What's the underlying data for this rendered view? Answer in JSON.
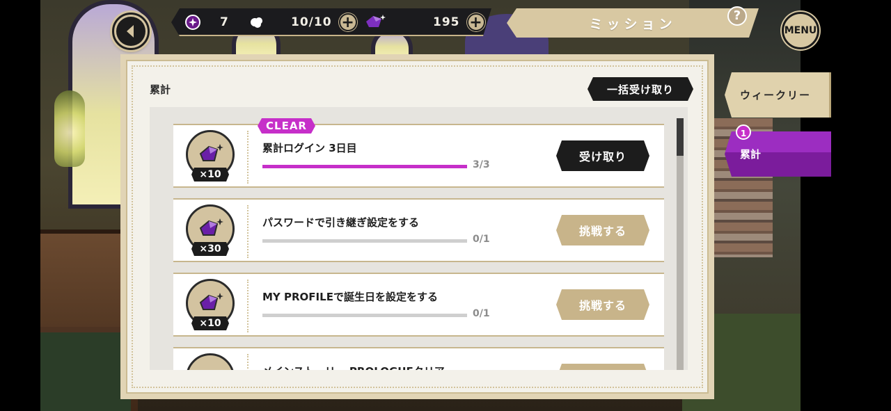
{
  "top_bar": {
    "event_currency": "7",
    "stamina": "10/10",
    "gems": "195",
    "mission_title": "ミッション",
    "help": "?",
    "menu": "MENU"
  },
  "panel": {
    "section_label": "累計",
    "claim_all": "一括受け取り"
  },
  "missions": [
    {
      "clear": "CLEAR",
      "reward_count": "×10",
      "name": "累計ログイン 3日目",
      "progress_text": "3/3",
      "progress": 1.0,
      "action": "受け取り"
    },
    {
      "reward_count": "×30",
      "name": "パスワードで引き継ぎ設定をする",
      "progress_text": "0/1",
      "progress": 0.0,
      "action": "挑戦する"
    },
    {
      "reward_count": "×10",
      "name": "MY PROFILEで誕生日を設定をする",
      "progress_text": "0/1",
      "progress": 0.0,
      "action": "挑戦する"
    },
    {
      "name": "メインストーリー PROLOGUEクリア"
    }
  ],
  "tabs": {
    "weekly": "ウィークリー",
    "cumulative": "累計",
    "cumulative_badge": "1"
  },
  "colors": {
    "accent_magenta": "#c62fc9",
    "tab_active_purple": "#7b1c9c",
    "gold": "#c8b48a",
    "button_dark": "#1c1c1c"
  },
  "icons": [
    "back-arrow-icon",
    "event-token-icon",
    "stamina-icon",
    "gem-icon",
    "plus-icon",
    "help-icon",
    "gem-reward-icon"
  ]
}
